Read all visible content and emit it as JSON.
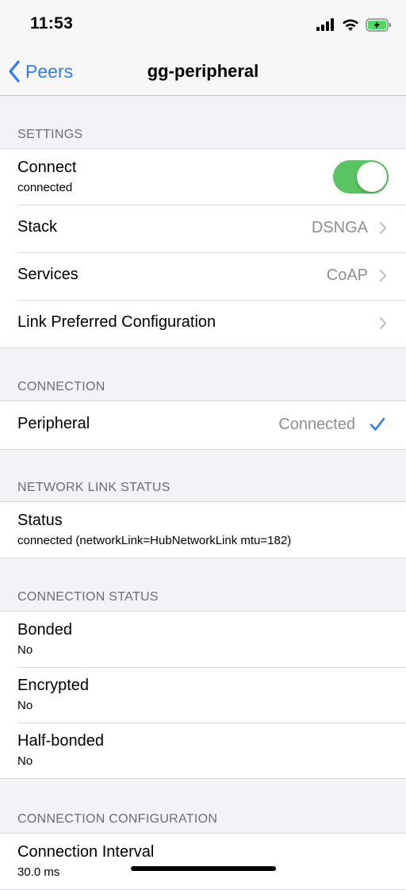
{
  "status_bar": {
    "time": "11:53"
  },
  "nav": {
    "back_label": "Peers",
    "title": "gg-peripheral"
  },
  "settings": {
    "header": "SETTINGS",
    "connect": {
      "title": "Connect",
      "subtitle": "connected",
      "toggle_on": true
    },
    "stack": {
      "title": "Stack",
      "value": "DSNGA"
    },
    "services": {
      "title": "Services",
      "value": "CoAP"
    },
    "link_pref": {
      "title": "Link Preferred Configuration"
    }
  },
  "connection": {
    "header": "CONNECTION",
    "peripheral": {
      "title": "Peripheral",
      "value": "Connected"
    }
  },
  "network_link": {
    "header": "NETWORK LINK STATUS",
    "status": {
      "title": "Status",
      "subtitle": "connected (networkLink=HubNetworkLink mtu=182)"
    }
  },
  "connection_status": {
    "header": "CONNECTION STATUS",
    "bonded": {
      "title": "Bonded",
      "subtitle": "No"
    },
    "encrypted": {
      "title": "Encrypted",
      "subtitle": "No"
    },
    "half_bonded": {
      "title": "Half-bonded",
      "subtitle": "No"
    }
  },
  "connection_config": {
    "header": "CONNECTION CONFIGURATION",
    "interval": {
      "title": "Connection Interval",
      "subtitle": "30.0 ms"
    }
  },
  "colors": {
    "accent": "#2f7cf6",
    "toggle_on": "#5ac463",
    "background": "#f2f2f7"
  }
}
